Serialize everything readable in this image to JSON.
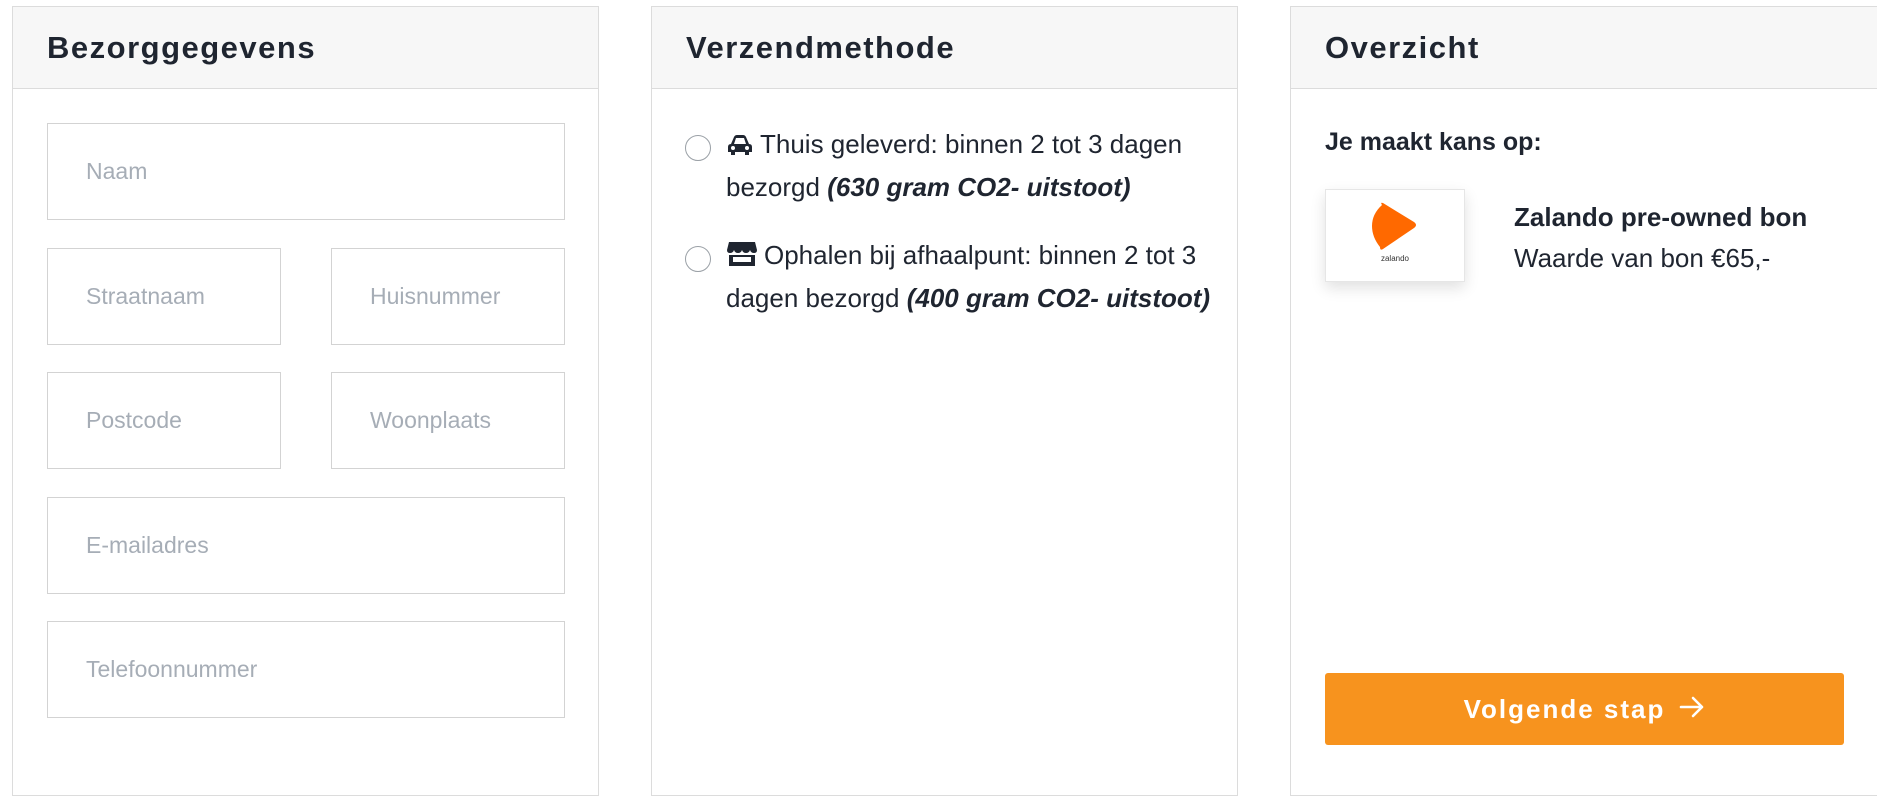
{
  "delivery": {
    "title": "Bezorggegevens",
    "fields": {
      "name": {
        "placeholder": "Naam",
        "value": ""
      },
      "street": {
        "placeholder": "Straatnaam",
        "value": ""
      },
      "house_number": {
        "placeholder": "Huisnummer",
        "value": ""
      },
      "postcode": {
        "placeholder": "Postcode",
        "value": ""
      },
      "city": {
        "placeholder": "Woonplaats",
        "value": ""
      },
      "email": {
        "placeholder": "E-mailadres",
        "value": ""
      },
      "phone": {
        "placeholder": "Telefoonnummer",
        "value": ""
      }
    }
  },
  "shipping": {
    "title": "Verzendmethode",
    "options": [
      {
        "icon": "car-icon",
        "text": "Thuis geleverd: binnen 2 tot 3 dagen bezorgd",
        "co2": "(630 gram CO2- uitstoot)",
        "selected": false
      },
      {
        "icon": "store-icon",
        "text": "Ophalen bij afhaalpunt: binnen 2 tot 3 dagen bezorgd",
        "co2": "(400 gram CO2- uitstoot)",
        "selected": false
      }
    ]
  },
  "overview": {
    "title": "Overzicht",
    "chance_label": "Je maakt kans op:",
    "voucher": {
      "brand": "zalando",
      "name": "Zalando pre-owned bon",
      "value": "Waarde van bon €65,-"
    },
    "next_button": {
      "label": "Volgende stap",
      "icon": "arrow-right-icon"
    }
  },
  "colors": {
    "accent": "#f7931e",
    "zalando_orange": "#ff6900",
    "header_bg": "#f7f7f7",
    "border": "#dcdcdc"
  }
}
